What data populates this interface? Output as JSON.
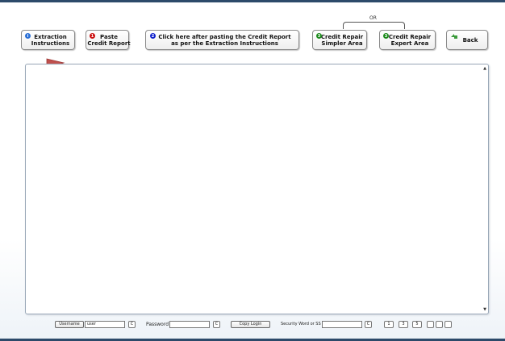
{
  "toolbar": {
    "extraction": {
      "line1": "Extraction",
      "line2": "Instructions",
      "badge": "i",
      "badge_color": "#2a6fd6"
    },
    "paste": {
      "line1": "Paste",
      "line2": "Credit Report",
      "badge": "1",
      "badge_color": "#cc1111"
    },
    "submit": {
      "line1": "Click here after pasting the Credit Report",
      "line2": "as per the Extraction Instructions",
      "badge": "2",
      "badge_color": "#1122cc"
    },
    "simpler": {
      "line1": "Credit Repair",
      "line2": "Simpler Area",
      "badge": "3",
      "badge_color": "#1a8a1a"
    },
    "expert": {
      "line1": "Credit Repair",
      "line2": "Expert Area",
      "badge": "3",
      "badge_color": "#1a8a1a"
    },
    "back": {
      "label": "Back",
      "icon": "back-arrow-icon"
    },
    "or_label": "OR"
  },
  "report_textarea": {
    "value": ""
  },
  "footer": {
    "username_label": "Username",
    "username_value": "user",
    "copy_icon_glyph": "C",
    "password_label": "Password",
    "password_value": "",
    "copy_login_label": "Copy Login",
    "security_label": "Security Word or SS",
    "security_value": "",
    "num_1": "1",
    "num_3": "3",
    "num_5": "5"
  },
  "colors": {
    "accent": "#2d4a6a",
    "arrow": "#c0504d"
  }
}
